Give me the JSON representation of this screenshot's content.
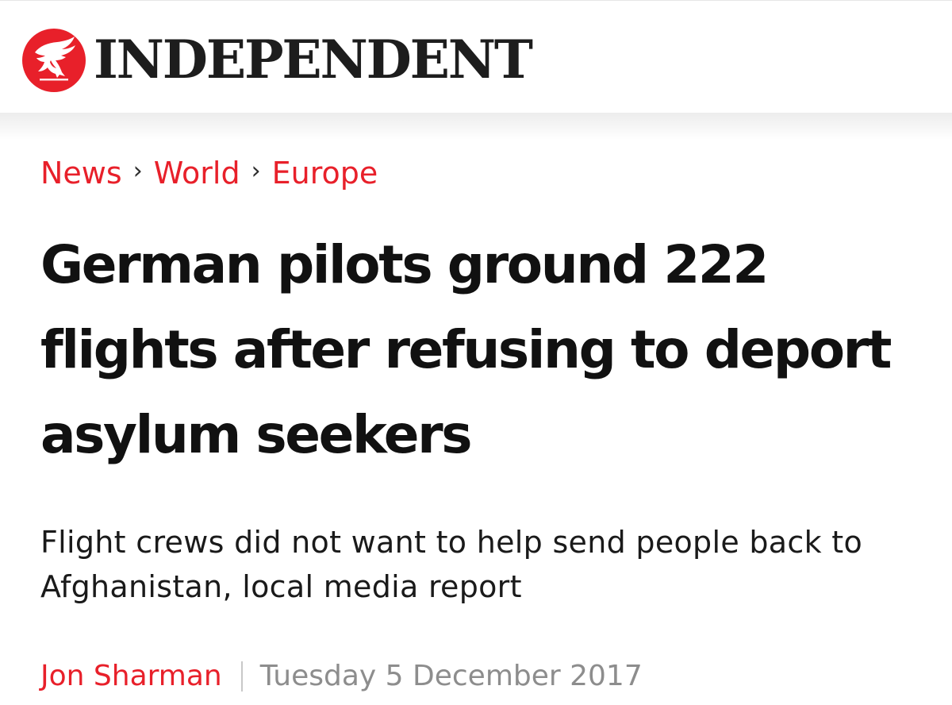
{
  "masthead": {
    "logo_icon": "eagle-logo-icon",
    "brand_color": "#e8202a",
    "wordmark": "INDEPENDENT"
  },
  "breadcrumb": {
    "items": [
      "News",
      "World",
      "Europe"
    ],
    "separator": "›"
  },
  "article": {
    "headline": "German pilots ground 222 flights after refusing to deport asylum seekers",
    "standfirst": "Flight crews did not want to help send people back to Afghanistan, local media report",
    "author": "Jon Sharman",
    "date": "Tuesday 5 December 2017"
  },
  "colors": {
    "accent": "#e8202a",
    "text": "#111111",
    "muted": "#8d8d8d"
  }
}
